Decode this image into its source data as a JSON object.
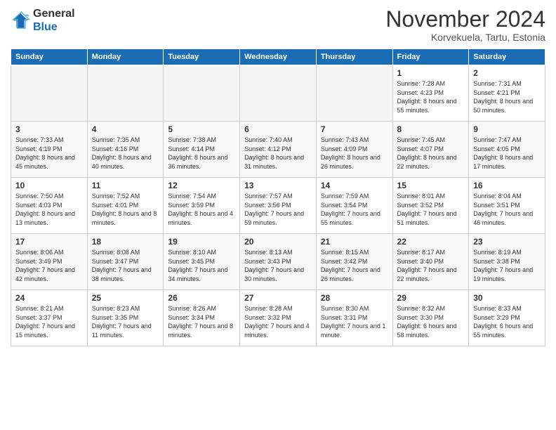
{
  "header": {
    "logo_general": "General",
    "logo_blue": "Blue",
    "title": "November 2024",
    "location": "Korvekuela, Tartu, Estonia"
  },
  "weekdays": [
    "Sunday",
    "Monday",
    "Tuesday",
    "Wednesday",
    "Thursday",
    "Friday",
    "Saturday"
  ],
  "weeks": [
    [
      {
        "day": "",
        "info": ""
      },
      {
        "day": "",
        "info": ""
      },
      {
        "day": "",
        "info": ""
      },
      {
        "day": "",
        "info": ""
      },
      {
        "day": "",
        "info": ""
      },
      {
        "day": "1",
        "info": "Sunrise: 7:28 AM\nSunset: 4:23 PM\nDaylight: 8 hours and 55 minutes."
      },
      {
        "day": "2",
        "info": "Sunrise: 7:31 AM\nSunset: 4:21 PM\nDaylight: 8 hours and 50 minutes."
      }
    ],
    [
      {
        "day": "3",
        "info": "Sunrise: 7:33 AM\nSunset: 4:19 PM\nDaylight: 8 hours and 45 minutes."
      },
      {
        "day": "4",
        "info": "Sunrise: 7:35 AM\nSunset: 4:16 PM\nDaylight: 8 hours and 40 minutes."
      },
      {
        "day": "5",
        "info": "Sunrise: 7:38 AM\nSunset: 4:14 PM\nDaylight: 8 hours and 36 minutes."
      },
      {
        "day": "6",
        "info": "Sunrise: 7:40 AM\nSunset: 4:12 PM\nDaylight: 8 hours and 31 minutes."
      },
      {
        "day": "7",
        "info": "Sunrise: 7:43 AM\nSunset: 4:09 PM\nDaylight: 8 hours and 26 minutes."
      },
      {
        "day": "8",
        "info": "Sunrise: 7:45 AM\nSunset: 4:07 PM\nDaylight: 8 hours and 22 minutes."
      },
      {
        "day": "9",
        "info": "Sunrise: 7:47 AM\nSunset: 4:05 PM\nDaylight: 8 hours and 17 minutes."
      }
    ],
    [
      {
        "day": "10",
        "info": "Sunrise: 7:50 AM\nSunset: 4:03 PM\nDaylight: 8 hours and 13 minutes."
      },
      {
        "day": "11",
        "info": "Sunrise: 7:52 AM\nSunset: 4:01 PM\nDaylight: 8 hours and 8 minutes."
      },
      {
        "day": "12",
        "info": "Sunrise: 7:54 AM\nSunset: 3:59 PM\nDaylight: 8 hours and 4 minutes."
      },
      {
        "day": "13",
        "info": "Sunrise: 7:57 AM\nSunset: 3:56 PM\nDaylight: 7 hours and 59 minutes."
      },
      {
        "day": "14",
        "info": "Sunrise: 7:59 AM\nSunset: 3:54 PM\nDaylight: 7 hours and 55 minutes."
      },
      {
        "day": "15",
        "info": "Sunrise: 8:01 AM\nSunset: 3:52 PM\nDaylight: 7 hours and 51 minutes."
      },
      {
        "day": "16",
        "info": "Sunrise: 8:04 AM\nSunset: 3:51 PM\nDaylight: 7 hours and 46 minutes."
      }
    ],
    [
      {
        "day": "17",
        "info": "Sunrise: 8:06 AM\nSunset: 3:49 PM\nDaylight: 7 hours and 42 minutes."
      },
      {
        "day": "18",
        "info": "Sunrise: 8:08 AM\nSunset: 3:47 PM\nDaylight: 7 hours and 38 minutes."
      },
      {
        "day": "19",
        "info": "Sunrise: 8:10 AM\nSunset: 3:45 PM\nDaylight: 7 hours and 34 minutes."
      },
      {
        "day": "20",
        "info": "Sunrise: 8:13 AM\nSunset: 3:43 PM\nDaylight: 7 hours and 30 minutes."
      },
      {
        "day": "21",
        "info": "Sunrise: 8:15 AM\nSunset: 3:42 PM\nDaylight: 7 hours and 26 minutes."
      },
      {
        "day": "22",
        "info": "Sunrise: 8:17 AM\nSunset: 3:40 PM\nDaylight: 7 hours and 22 minutes."
      },
      {
        "day": "23",
        "info": "Sunrise: 8:19 AM\nSunset: 3:38 PM\nDaylight: 7 hours and 19 minutes."
      }
    ],
    [
      {
        "day": "24",
        "info": "Sunrise: 8:21 AM\nSunset: 3:37 PM\nDaylight: 7 hours and 15 minutes."
      },
      {
        "day": "25",
        "info": "Sunrise: 8:23 AM\nSunset: 3:35 PM\nDaylight: 7 hours and 11 minutes."
      },
      {
        "day": "26",
        "info": "Sunrise: 8:26 AM\nSunset: 3:34 PM\nDaylight: 7 hours and 8 minutes."
      },
      {
        "day": "27",
        "info": "Sunrise: 8:28 AM\nSunset: 3:32 PM\nDaylight: 7 hours and 4 minutes."
      },
      {
        "day": "28",
        "info": "Sunrise: 8:30 AM\nSunset: 3:31 PM\nDaylight: 7 hours and 1 minute."
      },
      {
        "day": "29",
        "info": "Sunrise: 8:32 AM\nSunset: 3:30 PM\nDaylight: 6 hours and 58 minutes."
      },
      {
        "day": "30",
        "info": "Sunrise: 8:33 AM\nSunset: 3:29 PM\nDaylight: 6 hours and 55 minutes."
      }
    ]
  ]
}
